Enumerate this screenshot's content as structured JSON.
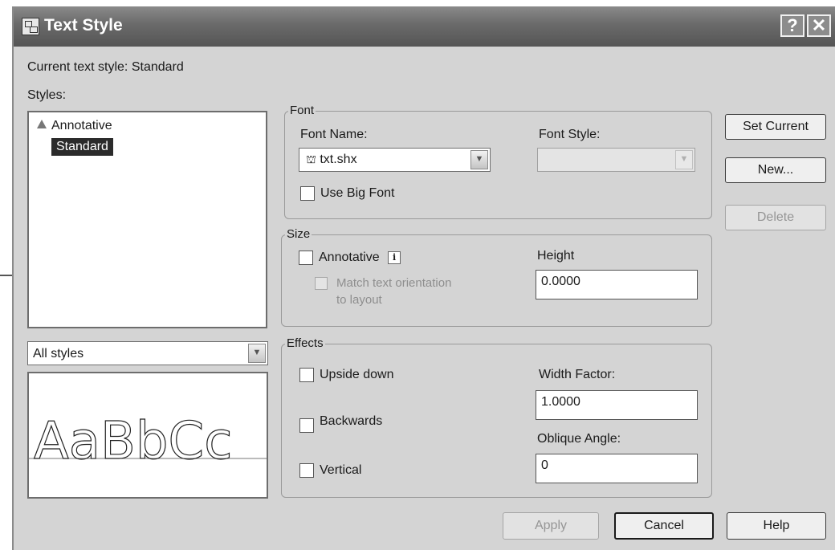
{
  "window": {
    "title": "Text Style",
    "help_glyph": "?",
    "close_glyph": "✕",
    "icon": "text-style-icon"
  },
  "current_style": {
    "label": "Current text style:",
    "value": "Standard"
  },
  "styles": {
    "label": "Styles:",
    "items": [
      {
        "label": "Annotative",
        "icon": "annotative-icon",
        "selected": false
      },
      {
        "label": "Standard",
        "selected": true
      }
    ],
    "filter_value": "All styles"
  },
  "preview": {
    "sample_text": "AaBbCc"
  },
  "font": {
    "group_label": "Font",
    "name_label": "Font Name:",
    "name_value": "txt.shx",
    "name_icon": "shx-font-icon",
    "style_label": "Font Style:",
    "style_value": "",
    "big_font_label": "Use Big Font",
    "big_font_checked": false
  },
  "size": {
    "group_label": "Size",
    "annotative_label": "Annotative",
    "annotative_checked": false,
    "info_glyph": "i",
    "match_line1": "Match text orientation",
    "match_line2": "to layout",
    "height_label": "Height",
    "height_value": "0.0000"
  },
  "effects": {
    "group_label": "Effects",
    "upside_down_label": "Upside down",
    "backwards_label": "Backwards",
    "vertical_label": "Vertical",
    "width_factor_label": "Width Factor:",
    "width_factor_value": "1.0000",
    "oblique_angle_label": "Oblique Angle:",
    "oblique_angle_value": "0"
  },
  "buttons": {
    "set_current": "Set Current",
    "new": "New...",
    "delete": "Delete",
    "apply": "Apply",
    "cancel": "Cancel",
    "help": "Help"
  },
  "colors": {
    "titlebar": "#6a6a6a",
    "dialog_bg": "#d4d4d4",
    "selection": "#2b2b2b"
  }
}
